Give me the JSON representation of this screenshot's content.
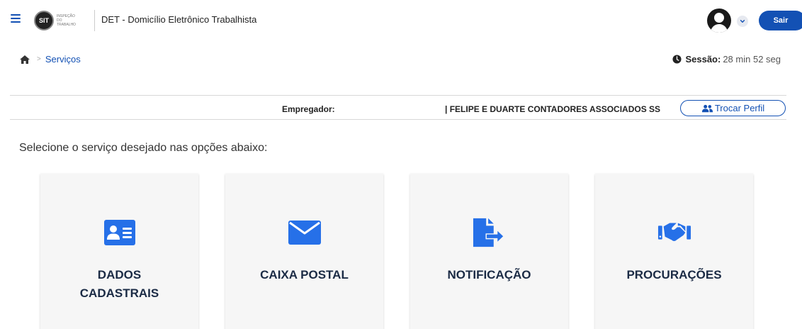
{
  "header": {
    "app_title": "DET - Domicílio Eletrônico Trabalhista",
    "logo_text": "SIT",
    "logo_subtitle": "Inspeção do Trabalho",
    "sair_label": "Sair"
  },
  "breadcrumb": {
    "current": "Serviços"
  },
  "session": {
    "label": "Sessão:",
    "remaining": "28 min 52 seg"
  },
  "employer": {
    "label": "Empregador:",
    "name": "| FELIPE E DUARTE CONTADORES ASSOCIADOS SS",
    "switch_label": "Trocar Perfil"
  },
  "instruction": "Selecione o serviço desejado nas opções abaixo:",
  "cards": [
    {
      "label_line1": "DADOS",
      "label_line2": "CADASTRAIS",
      "icon": "id-card-icon"
    },
    {
      "label_line1": "CAIXA POSTAL",
      "label_line2": "",
      "icon": "envelope-icon"
    },
    {
      "label_line1": "NOTIFICAÇÃO",
      "label_line2": "",
      "icon": "file-export-icon"
    },
    {
      "label_line1": "PROCURAÇÕES",
      "label_line2": "",
      "icon": "handshake-icon"
    }
  ],
  "colors": {
    "primary": "#1351b4",
    "icon": "#2670e8",
    "card_bg": "#f6f6f6",
    "card_text": "#1b2b45"
  }
}
